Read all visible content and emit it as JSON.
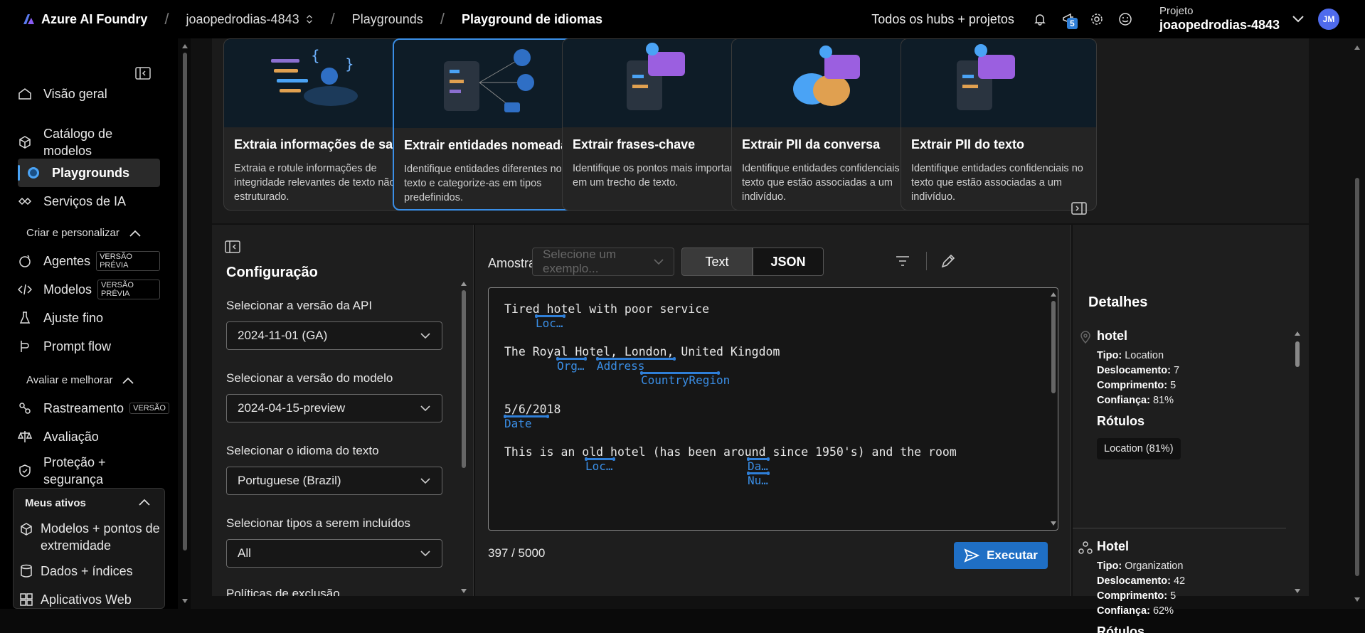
{
  "topbar": {
    "brand": "Azure AI Foundry",
    "hub": "joaopedrodias-4843",
    "crumb_playgrounds": "Playgrounds",
    "crumb_current": "Playground de idiomas",
    "hubs_projects": "Todos os hubs + projetos",
    "notification_count": "5",
    "project_label": "Projeto",
    "project_name": "joaopedrodias-4843",
    "avatar_initials": "JM"
  },
  "sidebar": {
    "items": [
      {
        "label": "Visão geral"
      },
      {
        "label": "Catálogo de modelos"
      },
      {
        "label": "Playgrounds"
      },
      {
        "label": "Serviços de IA"
      }
    ],
    "section_build": "Criar e personalizar",
    "build_items": [
      {
        "label": "Agentes",
        "tag": "VERSÃO PRÉVIA"
      },
      {
        "label": "Modelos",
        "tag": "VERSÃO PRÉVIA"
      },
      {
        "label": "Ajuste fino"
      },
      {
        "label": "Prompt flow"
      }
    ],
    "section_eval": "Avaliar e melhorar",
    "eval_items": [
      {
        "label": "Rastreamento",
        "tag": "VERSÃO"
      },
      {
        "label": "Avaliação"
      },
      {
        "label": "Proteção + segurança"
      }
    ],
    "section_assets": "Meus ativos",
    "asset_items": [
      {
        "label": "Modelos + pontos de extremidade"
      },
      {
        "label": "Dados + índices"
      },
      {
        "label": "Aplicativos Web"
      }
    ]
  },
  "cards": [
    {
      "title": "Extraia informações de saúde",
      "desc": "Extraia e rotule informações de integridade relevantes de texto não estruturado."
    },
    {
      "title": "Extrair entidades nomeadas",
      "desc": "Identifique entidades diferentes no texto e categorize-as em tipos predefinidos."
    },
    {
      "title": "Extrair frases-chave",
      "desc": "Identifique os pontos mais importantes em um trecho de texto."
    },
    {
      "title": "Extrair PII da conversa",
      "desc": "Identifique entidades confidenciais no texto que estão associadas a um indivíduo."
    },
    {
      "title": "Extrair PII do texto",
      "desc": "Identifique entidades confidenciais no texto que estão associadas a um indivíduo."
    }
  ],
  "config": {
    "title": "Configuração",
    "api_label": "Selecionar a versão da API",
    "api_value": "2024-11-01 (GA)",
    "model_label": "Selecionar a versão do modelo",
    "model_value": "2024-04-15-preview",
    "lang_label": "Selecionar o idioma do texto",
    "lang_value": "Portuguese (Brazil)",
    "types_label": "Selecionar tipos a serem incluídos",
    "types_value": "All",
    "next_label": "Políticas de exclusão"
  },
  "center": {
    "sample_label": "Amostra",
    "sample_placeholder": "Selecione um exemplo...",
    "tab_text": "Text",
    "tab_json": "JSON",
    "lines": [
      "Tired hotel with poor service",
      "The Royal Hotel, London, United Kingdom",
      "5/6/2018",
      "This is an old hotel (has been around since 1950's) and the room"
    ],
    "entities": {
      "loc1": "Loc…",
      "org": "Org…",
      "address": "Address",
      "country": "CountryRegion",
      "date": "Date",
      "loc2": "Loc…",
      "da": "Da…",
      "nu": "Nu…"
    },
    "counter": "397 / 5000",
    "run_label": "Executar"
  },
  "details": {
    "title": "Detalhes",
    "entities": [
      {
        "name": "hotel",
        "tipo_k": "Tipo:",
        "tipo": "Location",
        "desl_k": "Deslocamento:",
        "desl": "7",
        "comp_k": "Comprimento:",
        "comp": "5",
        "conf_k": "Confiança:",
        "conf": "81%",
        "rotulos": "Rótulos",
        "chip": "Location (81%)"
      },
      {
        "name": "Hotel",
        "tipo_k": "Tipo:",
        "tipo": "Organization",
        "desl_k": "Deslocamento:",
        "desl": "42",
        "comp_k": "Comprimento:",
        "comp": "5",
        "conf_k": "Confiança:",
        "conf": "62%",
        "rotulos": "Rótulos"
      }
    ]
  },
  "colors": {
    "accent": "#3a8ee6",
    "run": "#1f6fc5",
    "avatar": "#4f6bed"
  }
}
